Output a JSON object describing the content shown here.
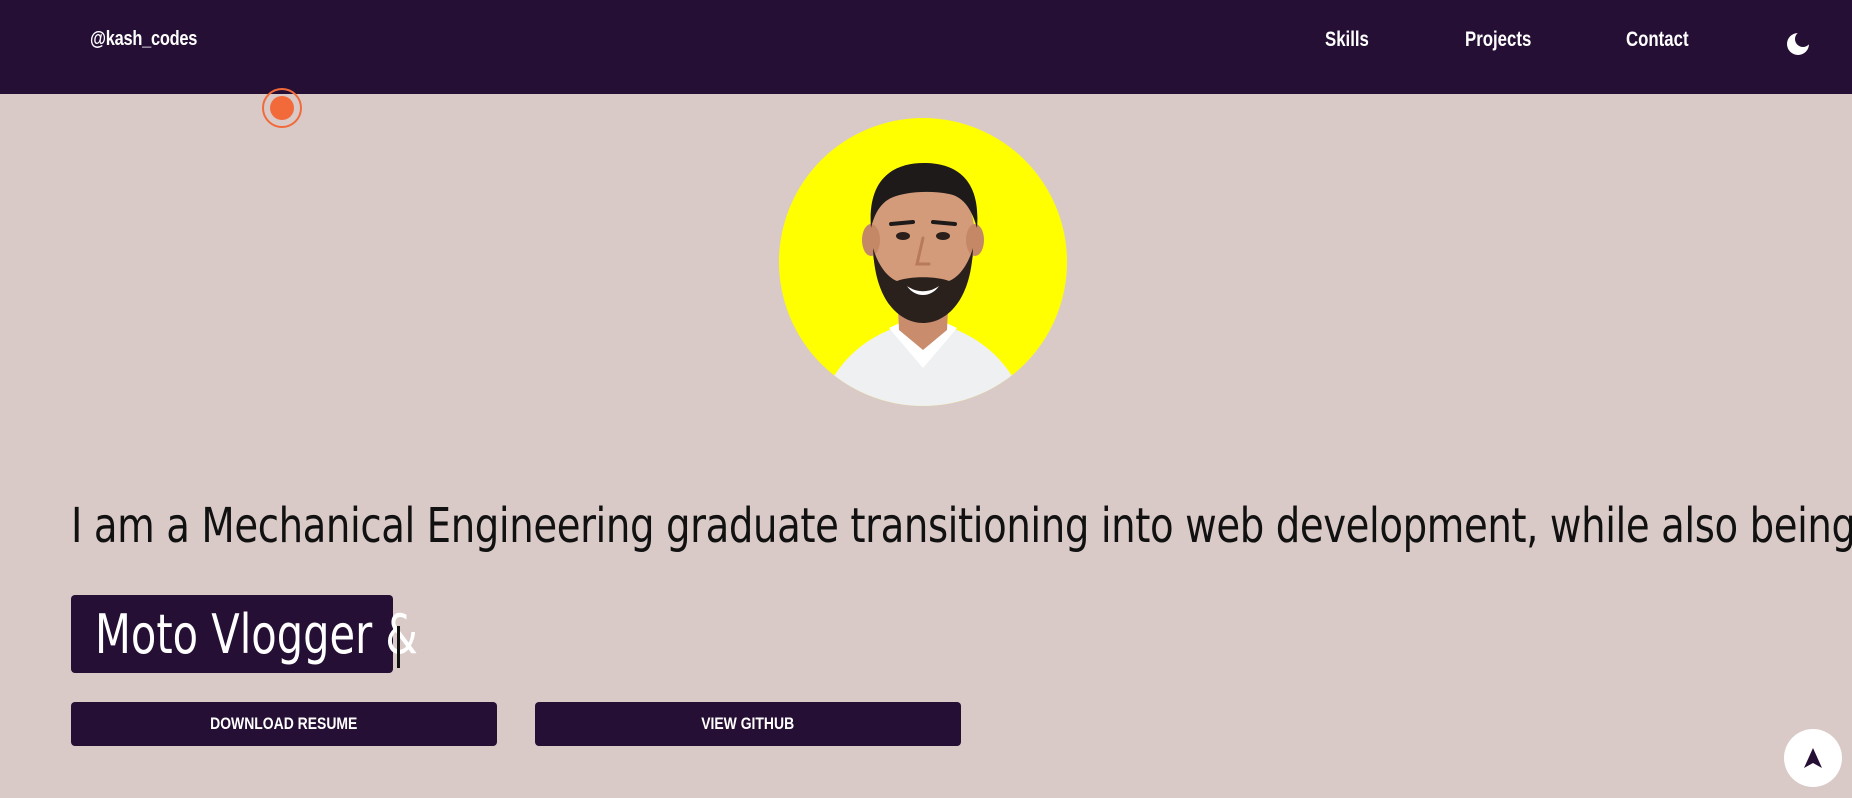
{
  "nav": {
    "brand": "@kash_codes",
    "links": [
      {
        "label": "Skills"
      },
      {
        "label": "Projects"
      },
      {
        "label": "Contact"
      }
    ],
    "theme_icon": "moon-icon"
  },
  "hero": {
    "intro": "I am a Mechanical Engineering graduate transitioning into web development, while also being",
    "role_typed": "Moto Vlogger &"
  },
  "buttons": {
    "resume": "DOWNLOAD RESUME",
    "github": "VIEW GITHUB"
  },
  "colors": {
    "nav_bg": "#260f35",
    "page_bg": "#d9cac7",
    "avatar_bg": "#ffff00",
    "accent": "#f26a3a"
  },
  "icons": {
    "scroll_top": "navigation-arrow-icon",
    "cursor": "cursor-dot-icon"
  }
}
